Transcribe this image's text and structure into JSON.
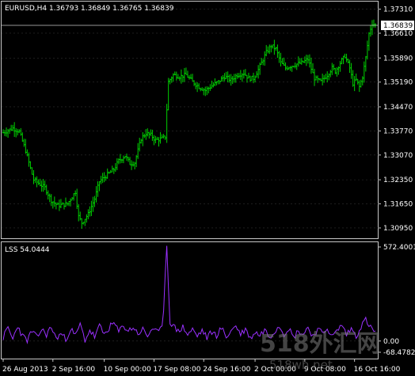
{
  "chart_data": [
    {
      "type": "ohlc",
      "title": "EURUSD,H4  1.36793 1.36849 1.36765 1.36839",
      "last_price": "1.36839",
      "ylim": [
        1.3065,
        1.3753
      ],
      "y_ticks": [
        "1.37310",
        "1.36610",
        "1.35890",
        "1.35190",
        "1.34470",
        "1.33770",
        "1.33070",
        "1.32350",
        "1.31650",
        "1.30950"
      ],
      "x_labels": [
        "26 Aug 2013",
        "2 Sep 16:00",
        "10 Sep 00:00",
        "17 Sep 08:00",
        "24 Sep 16:00",
        "2 Oct 00:00",
        "9 Oct 08:00",
        "16 Oct 16:00"
      ],
      "bar_color": "#00d000",
      "anchors": [
        [
          0,
          1.3372
        ],
        [
          6,
          1.3385
        ],
        [
          10,
          1.3375
        ],
        [
          14,
          1.332
        ],
        [
          17,
          1.3268
        ],
        [
          19,
          1.3235
        ],
        [
          26,
          1.3212
        ],
        [
          30,
          1.3175
        ],
        [
          34,
          1.316
        ],
        [
          40,
          1.3165
        ],
        [
          45,
          1.32
        ],
        [
          47,
          1.3128
        ],
        [
          49,
          1.311
        ],
        [
          53,
          1.3135
        ],
        [
          57,
          1.318
        ],
        [
          60,
          1.323
        ],
        [
          65,
          1.325
        ],
        [
          69,
          1.3265
        ],
        [
          72,
          1.329
        ],
        [
          76,
          1.3305
        ],
        [
          79,
          1.3282
        ],
        [
          82,
          1.3285
        ],
        [
          86,
          1.3355
        ],
        [
          89,
          1.337
        ],
        [
          92,
          1.3365
        ],
        [
          95,
          1.335
        ],
        [
          99,
          1.3355
        ],
        [
          101,
          1.336
        ],
        [
          103,
          1.352
        ],
        [
          106,
          1.354
        ],
        [
          110,
          1.3535
        ],
        [
          114,
          1.354
        ],
        [
          118,
          1.352
        ],
        [
          122,
          1.3505
        ],
        [
          126,
          1.3495
        ],
        [
          130,
          1.3508
        ],
        [
          134,
          1.352
        ],
        [
          138,
          1.3535
        ],
        [
          142,
          1.3525
        ],
        [
          146,
          1.354
        ],
        [
          150,
          1.3545
        ],
        [
          153,
          1.353
        ],
        [
          156,
          1.353
        ],
        [
          159,
          1.3555
        ],
        [
          161,
          1.3575
        ],
        [
          164,
          1.3605
        ],
        [
          167,
          1.3625
        ],
        [
          170,
          1.3615
        ],
        [
          173,
          1.3575
        ],
        [
          176,
          1.356
        ],
        [
          179,
          1.3565
        ],
        [
          182,
          1.357
        ],
        [
          186,
          1.3575
        ],
        [
          190,
          1.3585
        ],
        [
          194,
          1.353
        ],
        [
          198,
          1.352
        ],
        [
          202,
          1.354
        ],
        [
          205,
          1.356
        ],
        [
          207,
          1.355
        ],
        [
          210,
          1.3575
        ],
        [
          213,
          1.3595
        ],
        [
          216,
          1.356
        ],
        [
          218,
          1.3515
        ],
        [
          220,
          1.3525
        ],
        [
          222,
          1.3505
        ],
        [
          224,
          1.3535
        ],
        [
          226,
          1.359
        ],
        [
          228,
          1.366
        ],
        [
          230,
          1.369
        ],
        [
          232,
          1.3684
        ]
      ]
    },
    {
      "type": "line",
      "title": "LSS 54.0444",
      "ylim": [
        -68.4782,
        572.4001
      ],
      "y_ticks": [
        "572.4001",
        "0.00",
        "-68.4782"
      ],
      "line_color": "#9a30ff",
      "anchors": [
        [
          0,
          20
        ],
        [
          3,
          80
        ],
        [
          6,
          10
        ],
        [
          9,
          95
        ],
        [
          12,
          30
        ],
        [
          15,
          5
        ],
        [
          18,
          60
        ],
        [
          21,
          20
        ],
        [
          24,
          70
        ],
        [
          27,
          40
        ],
        [
          30,
          85
        ],
        [
          33,
          15
        ],
        [
          36,
          45
        ],
        [
          39,
          10
        ],
        [
          42,
          75
        ],
        [
          45,
          30
        ],
        [
          48,
          100
        ],
        [
          51,
          5
        ],
        [
          54,
          65
        ],
        [
          57,
          25
        ],
        [
          60,
          90
        ],
        [
          63,
          40
        ],
        [
          66,
          80
        ],
        [
          69,
          110
        ],
        [
          72,
          55
        ],
        [
          75,
          95
        ],
        [
          78,
          60
        ],
        [
          81,
          85
        ],
        [
          84,
          45
        ],
        [
          87,
          70
        ],
        [
          90,
          30
        ],
        [
          93,
          80
        ],
        [
          96,
          50
        ],
        [
          99,
          75
        ],
        [
          100,
          200
        ],
        [
          101,
          420
        ],
        [
          102,
          580
        ],
        [
          103,
          330
        ],
        [
          104,
          120
        ],
        [
          106,
          90
        ],
        [
          109,
          60
        ],
        [
          112,
          85
        ],
        [
          115,
          40
        ],
        [
          118,
          70
        ],
        [
          121,
          30
        ],
        [
          124,
          65
        ],
        [
          127,
          20
        ],
        [
          130,
          55
        ],
        [
          133,
          35
        ],
        [
          136,
          80
        ],
        [
          139,
          25
        ],
        [
          142,
          60
        ],
        [
          145,
          95
        ],
        [
          148,
          40
        ],
        [
          151,
          75
        ],
        [
          154,
          15
        ],
        [
          157,
          55
        ],
        [
          160,
          35
        ],
        [
          163,
          70
        ],
        [
          166,
          25
        ],
        [
          169,
          60
        ],
        [
          172,
          95
        ],
        [
          175,
          45
        ],
        [
          178,
          80
        ],
        [
          181,
          20
        ],
        [
          184,
          65
        ],
        [
          187,
          40
        ],
        [
          190,
          85
        ],
        [
          193,
          30
        ],
        [
          196,
          70
        ],
        [
          199,
          45
        ],
        [
          202,
          80
        ],
        [
          205,
          25
        ],
        [
          208,
          60
        ],
        [
          211,
          100
        ],
        [
          214,
          40
        ],
        [
          217,
          75
        ],
        [
          220,
          30
        ],
        [
          223,
          90
        ],
        [
          226,
          130
        ],
        [
          229,
          80
        ],
        [
          232,
          54
        ]
      ]
    }
  ],
  "watermark": {
    "brand": "518外汇网",
    "url": "518wh.net"
  }
}
